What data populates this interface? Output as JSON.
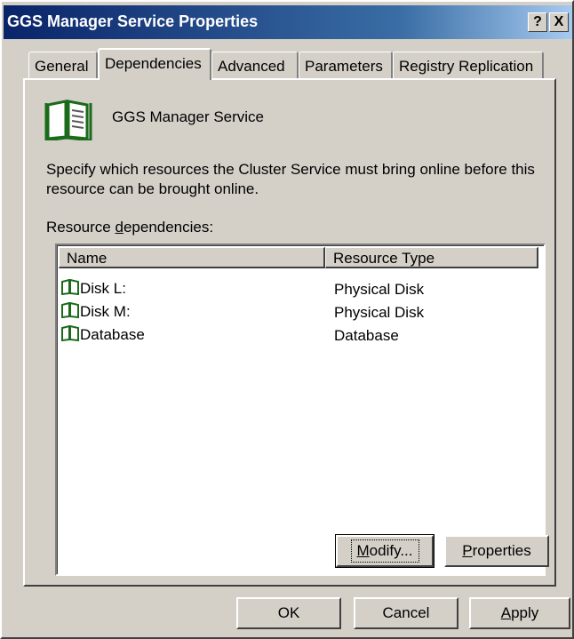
{
  "window": {
    "title": "GGS Manager Service Properties"
  },
  "titlebar_buttons": {
    "help": "?",
    "close": "X"
  },
  "tabs": [
    {
      "label": "General",
      "active": false
    },
    {
      "label": "Dependencies",
      "active": true
    },
    {
      "label": "Advanced",
      "active": false
    },
    {
      "label": "Parameters",
      "active": false
    },
    {
      "label": "Registry Replication",
      "active": false
    }
  ],
  "dependencies": {
    "resource_name": "GGS Manager Service",
    "resource_icon": "book-icon",
    "description": "Specify which resources the Cluster Service must bring online before this resource can be brought online.",
    "list_label_prefix": "Resource ",
    "list_label_accel": "d",
    "list_label_suffix": "ependencies:",
    "columns": [
      "Name",
      "Resource Type"
    ],
    "rows": [
      {
        "name": "Disk L:",
        "type": "Physical Disk",
        "icon": "book-icon"
      },
      {
        "name": "Disk M:",
        "type": "Physical Disk",
        "icon": "book-icon"
      },
      {
        "name": "Database",
        "type": "Database",
        "icon": "book-icon"
      }
    ],
    "modify_button": {
      "accel": "M",
      "rest": "odify..."
    },
    "properties_button": {
      "accel": "P",
      "rest": "roperties"
    }
  },
  "footer": {
    "ok": "OK",
    "cancel": "Cancel",
    "apply_accel": "A",
    "apply_rest": "pply"
  },
  "colors": {
    "titlebar_start": "#0a246a",
    "titlebar_end": "#a6caf0",
    "face": "#d4d0c8",
    "icon_green": "#1a6b1a"
  }
}
